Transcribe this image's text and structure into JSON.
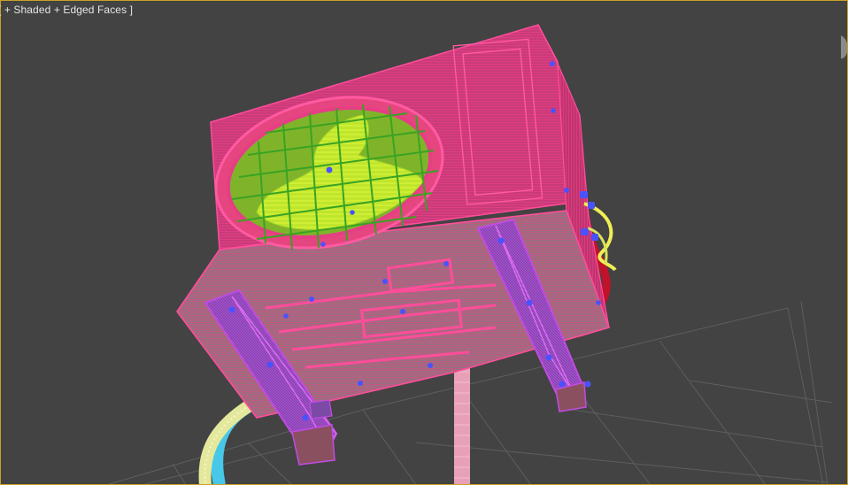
{
  "viewport": {
    "label": "[ + Shaded + Edged Faces ]",
    "border_color": "#c9a227",
    "background": "#434343"
  },
  "scene": {
    "object": "outdoor-ac-unit-wireframe",
    "colors": {
      "wire_body": "#e0357f",
      "wire_bracket": "#b23bd6",
      "fan_green": "#4ccf2a",
      "fan_yellow": "#d8f234",
      "vertex_blue": "#4a52ff",
      "pipe_red": "#c0122a",
      "cable_yellow": "#f0ee55",
      "hose_cyan": "#48c8e8",
      "pipe_pink": "#e8a0b8",
      "grid": "#5e5e5e"
    }
  }
}
